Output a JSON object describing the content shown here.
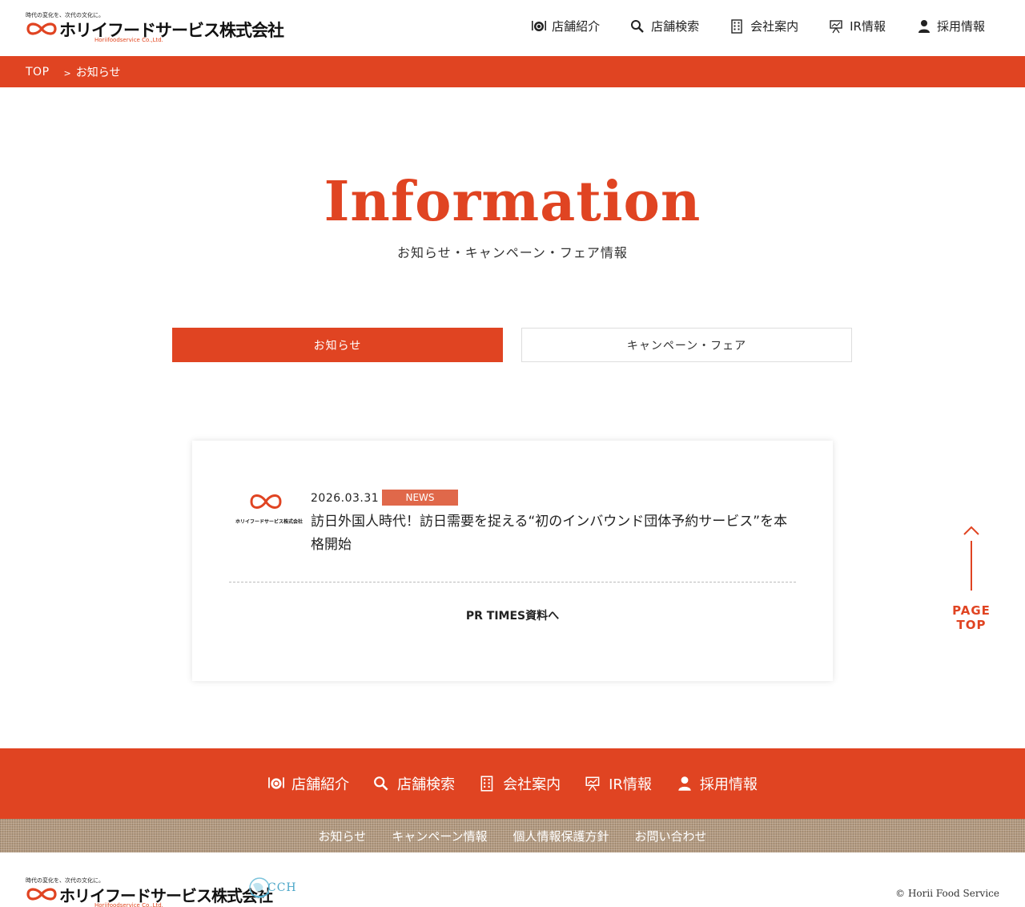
{
  "header": {
    "logo": {
      "tagline": "時代の変化を、次代の文化に。",
      "name": "ホリイフードサービス株式会社",
      "en": "Horiifoodservice Co.,Ltd."
    },
    "nav": [
      {
        "label": "店舗紹介",
        "icon": "dish-icon"
      },
      {
        "label": "店舗検索",
        "icon": "search-icon"
      },
      {
        "label": "会社案内",
        "icon": "building-icon"
      },
      {
        "label": "IR情報",
        "icon": "presentation-icon"
      },
      {
        "label": "採用情報",
        "icon": "person-icon"
      }
    ]
  },
  "breadcrumb": {
    "top": "TOP",
    "separator": ">",
    "current": "お知らせ"
  },
  "hero": {
    "title": "Information",
    "subtitle": "お知らせ・キャンペーン・フェア情報"
  },
  "tabs": {
    "active": "お知らせ",
    "inactive": "キャンペーン・フェア"
  },
  "news": {
    "date": "2026.03.31",
    "badge": "NEWS",
    "title": "訪日外国人時代！訪日需要を捉える“初のインバウンド団体予約サービス”を本格開始",
    "thumb_text": "ホリイフードサービス株式会社",
    "link": "PR TIMES資料へ"
  },
  "page_top": "PAGE TOP",
  "footer": {
    "nav": [
      {
        "label": "店舗紹介"
      },
      {
        "label": "店舗検索"
      },
      {
        "label": "会社案内"
      },
      {
        "label": "IR情報"
      },
      {
        "label": "採用情報"
      }
    ],
    "links": [
      "お知らせ",
      "キャンペーン情報",
      "個人情報保護方針",
      "お問い合わせ"
    ],
    "cch": "CCH",
    "copyright": "© Horii Food Service"
  },
  "colors": {
    "brand": "#e04422",
    "badge": "#e0684a",
    "footer_links_bg": "#b39a80"
  }
}
